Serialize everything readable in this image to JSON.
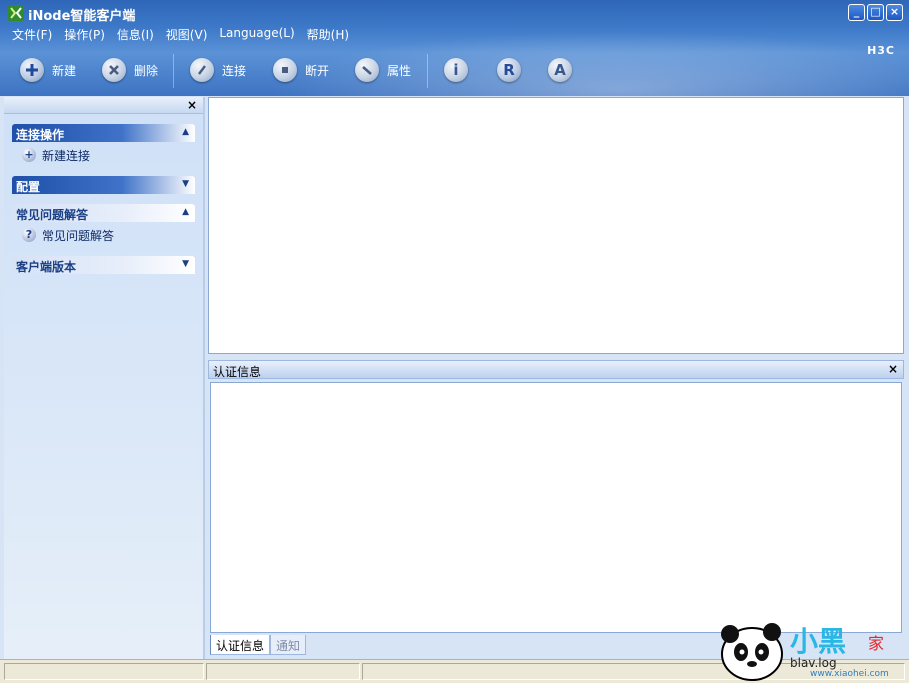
{
  "window": {
    "title": "iNode智能客户端",
    "brand": "H3C",
    "controls": {
      "minimize": "_",
      "maximize": "□",
      "close": "×"
    }
  },
  "menu": [
    {
      "label": "文件(F)"
    },
    {
      "label": "操作(P)"
    },
    {
      "label": "信息(I)"
    },
    {
      "label": "视图(V)"
    },
    {
      "label": "Language(L)"
    },
    {
      "label": "帮助(H)"
    }
  ],
  "toolbar": {
    "new": {
      "label": "新建",
      "icon": "plus-icon"
    },
    "delete": {
      "label": "删除",
      "icon": "x-circle-icon"
    },
    "connect": {
      "label": "连接",
      "icon": "connect-icon"
    },
    "disconnect": {
      "label": "断开",
      "icon": "stop-icon"
    },
    "properties": {
      "label": "属性",
      "icon": "wrench-icon"
    },
    "info_glyph": "i",
    "r_glyph": "R",
    "a_glyph": "A"
  },
  "sidebar": {
    "close": "×",
    "groups": [
      {
        "title": "连接操作",
        "arrow": "▲",
        "items": [
          {
            "label": "新建连接",
            "glyph": "+"
          }
        ]
      },
      {
        "title": "配置",
        "arrow": "▼",
        "items": []
      },
      {
        "title": "常见问题解答",
        "arrow": "▲",
        "items": [
          {
            "label": "常见问题解答",
            "glyph": "?"
          }
        ]
      },
      {
        "title": "客户端版本",
        "arrow": "▼",
        "items": []
      }
    ]
  },
  "auth_panel": {
    "title": "认证信息",
    "close": "×",
    "tabs": [
      {
        "label": "认证信息"
      },
      {
        "label": "通知"
      }
    ]
  },
  "watermark": {
    "main": "小黑",
    "side": "家",
    "url": "www.xiaohei.com",
    "overlay": "blav.log"
  }
}
